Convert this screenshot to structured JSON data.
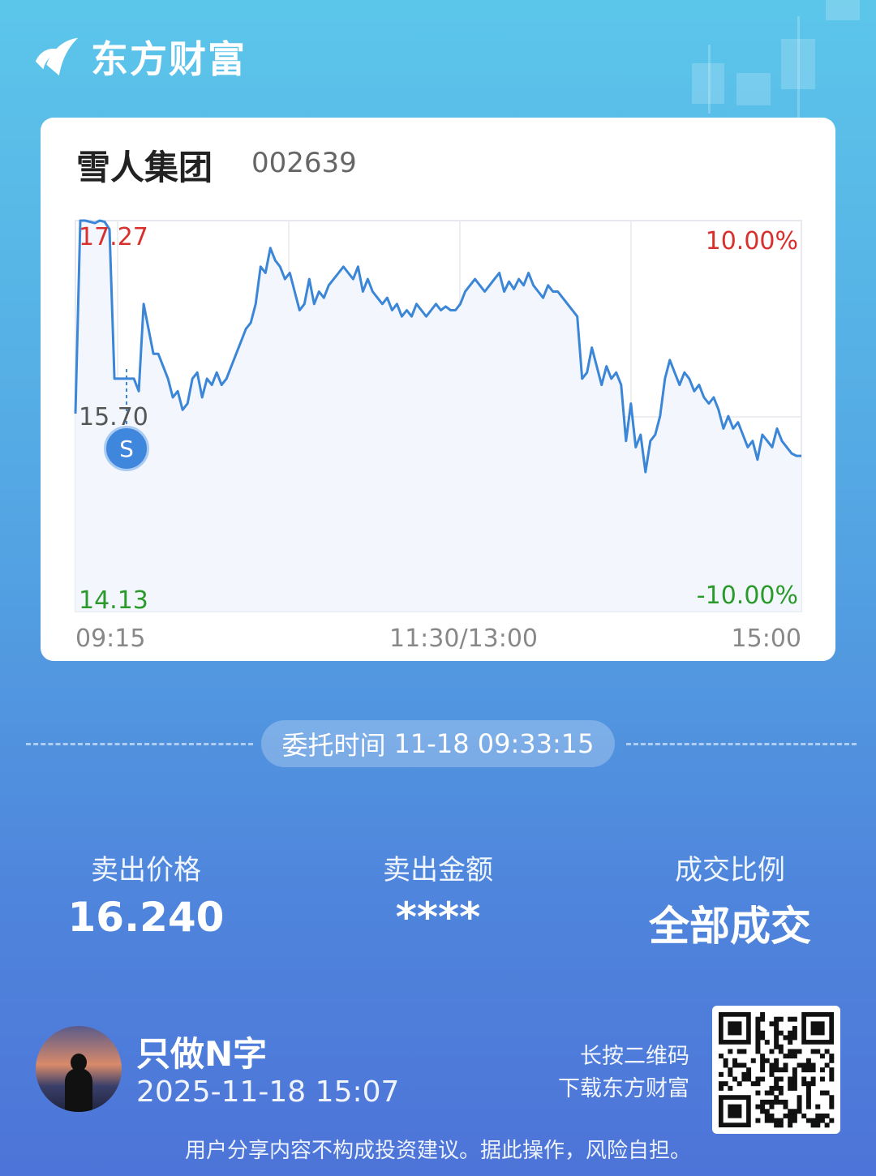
{
  "brand": {
    "name": "东方财富"
  },
  "stock": {
    "name": "雪人集团",
    "code": "002639"
  },
  "chart_data": {
    "type": "line",
    "y_high_label": "17.27",
    "y_mid_label": "15.70",
    "y_low_label": "14.13",
    "pct_high_label": "10.00%",
    "pct_low_label": "-10.00%",
    "time_start": "09:15",
    "time_mid": "11:30/13:00",
    "time_end": "15:00",
    "ylim": [
      14.13,
      17.27
    ],
    "series": [
      {
        "values": [
          15.72,
          17.27,
          17.27,
          17.26,
          17.25,
          17.27,
          17.26,
          17.2,
          16.0,
          16.0,
          16.0,
          16.0,
          16.0,
          15.9,
          16.6,
          16.4,
          16.2,
          16.2,
          16.1,
          16.0,
          15.85,
          15.9,
          15.75,
          15.8,
          16.0,
          16.05,
          15.85,
          16.0,
          15.95,
          16.05,
          15.95,
          16.0,
          16.1,
          16.2,
          16.3,
          16.4,
          16.45,
          16.6,
          16.9,
          16.85,
          17.05,
          16.95,
          16.9,
          16.8,
          16.85,
          16.7,
          16.55,
          16.6,
          16.8,
          16.6,
          16.7,
          16.65,
          16.75,
          16.8,
          16.85,
          16.9,
          16.85,
          16.8,
          16.9,
          16.7,
          16.8,
          16.7,
          16.65,
          16.6,
          16.65,
          16.55,
          16.6,
          16.5,
          16.55,
          16.5,
          16.6,
          16.55,
          16.5,
          16.55,
          16.6,
          16.55,
          16.58,
          16.55,
          16.55,
          16.6,
          16.7,
          16.75,
          16.8,
          16.75,
          16.7,
          16.75,
          16.8,
          16.85,
          16.7,
          16.78,
          16.72,
          16.8,
          16.75,
          16.85,
          16.75,
          16.7,
          16.65,
          16.75,
          16.7,
          16.7,
          16.65,
          16.6,
          16.55,
          16.5,
          16.0,
          16.05,
          16.25,
          16.1,
          15.95,
          16.1,
          16.0,
          16.05,
          15.95,
          15.5,
          15.8,
          15.45,
          15.55,
          15.25,
          15.5,
          15.55,
          15.7,
          16.0,
          16.15,
          16.05,
          15.95,
          16.05,
          16.0,
          15.9,
          15.95,
          15.85,
          15.8,
          15.85,
          15.75,
          15.6,
          15.7,
          15.6,
          15.65,
          15.55,
          15.45,
          15.5,
          15.35,
          15.55,
          15.5,
          15.45,
          15.6,
          15.5,
          15.45,
          15.4,
          15.38,
          15.38
        ]
      }
    ]
  },
  "sell_marker": {
    "label": "S"
  },
  "order": {
    "label": "委托时间",
    "time": "11-18 09:33:15"
  },
  "stats": [
    {
      "label": "卖出价格",
      "value": "16.240"
    },
    {
      "label": "卖出金额",
      "value": "****"
    },
    {
      "label": "成交比例",
      "value": "全部成交"
    }
  ],
  "user": {
    "name": "只做N字",
    "time": "2025-11-18 15:07"
  },
  "qr_hint": {
    "line1": "长按二维码",
    "line2": "下载东方财富"
  },
  "disclaimer": "用户分享内容不构成投资建议。据此操作，风险自担。",
  "colors": {
    "up": "#d8302d",
    "down": "#2a9a2a",
    "line": "#3b86d6"
  }
}
